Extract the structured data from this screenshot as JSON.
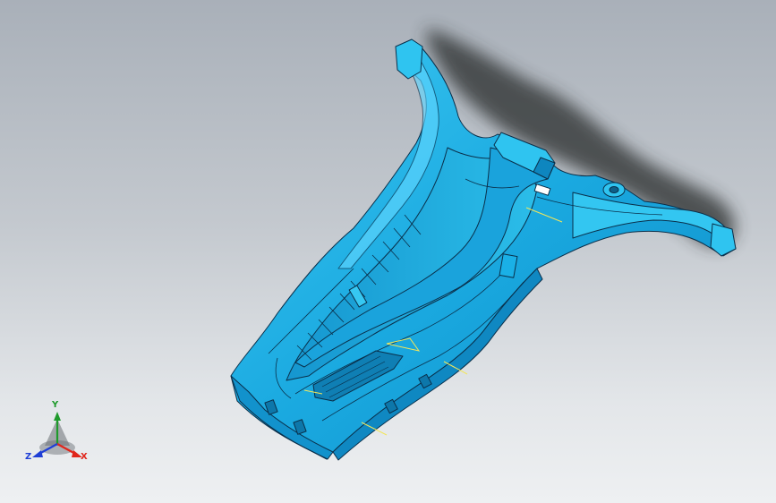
{
  "triad": {
    "labels": {
      "x": "X",
      "y": "Y",
      "z": "Z"
    },
    "colors": {
      "x": "#e0261c",
      "y": "#1f9a2c",
      "z": "#1f3fd6"
    }
  },
  "model": {
    "face_color": "#1fb6e8",
    "shade_color": "#0e86bf",
    "highlight_color": "#5fd6ff",
    "edge_color": "#0a2f4a",
    "sketch_color": "#f2e65a",
    "shadow_color": "#2e3133"
  }
}
